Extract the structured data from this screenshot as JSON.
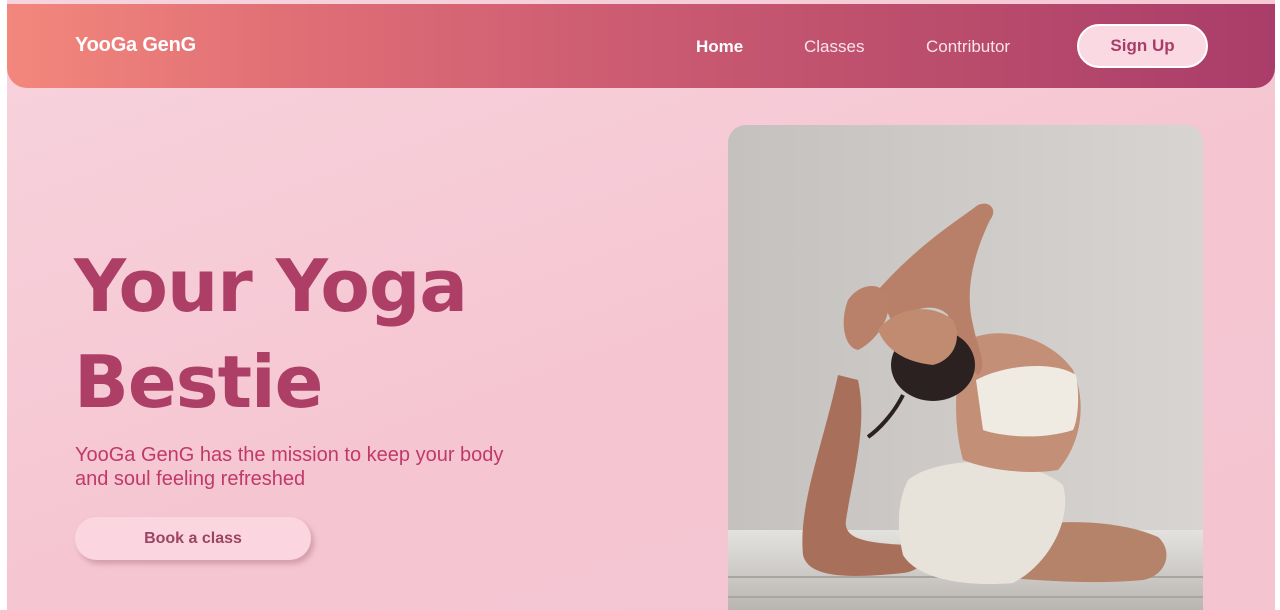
{
  "nav": {
    "brand": "YooGa GenG",
    "links": [
      "Home",
      "Classes",
      "Contributor"
    ],
    "signup_label": "Sign Up"
  },
  "hero": {
    "title_line1": "Your Yoga",
    "title_line2": "Bestie",
    "subtitle": "YooGa GenG has the mission to keep your body and soul feeling refreshed",
    "cta_label": "Book a class",
    "image_subject": "yoga-pose-photo"
  },
  "colors": {
    "nav_gradient_start": "#f3877c",
    "nav_gradient_end": "#a93d69",
    "page_background": "#f6cbd7",
    "title": "#ad3f66",
    "subtitle": "#c0396a",
    "button_background": "#fbd6e0"
  }
}
